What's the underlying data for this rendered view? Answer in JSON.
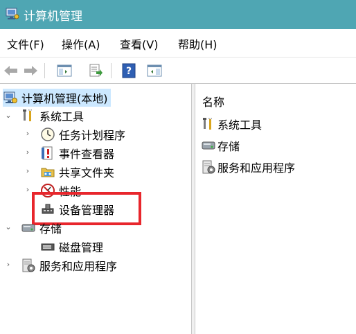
{
  "window": {
    "title": "计算机管理"
  },
  "menu": [
    "文件(F)",
    "操作(A)",
    "查看(V)",
    "帮助(H)"
  ],
  "toolbar": {
    "buttons": [
      "back-arrow-icon",
      "forward-arrow-icon",
      "console-tree-icon",
      "export-list-icon",
      "help-icon",
      "action-pane-icon"
    ]
  },
  "tree": {
    "root": "计算机管理(本地)",
    "system_tools": {
      "label": "系统工具",
      "children": [
        "任务计划程序",
        "事件查看器",
        "共享文件夹",
        "性能",
        "设备管理器"
      ]
    },
    "storage": {
      "label": "存储",
      "children": [
        "磁盘管理"
      ]
    },
    "services": "服务和应用程序"
  },
  "list": {
    "header": "名称",
    "items": [
      "系统工具",
      "存储",
      "服务和应用程序"
    ]
  },
  "colors": {
    "titlebar": "#4fa6b3",
    "selected_row": "#cce8ff",
    "highlight_box": "#e8262c"
  }
}
